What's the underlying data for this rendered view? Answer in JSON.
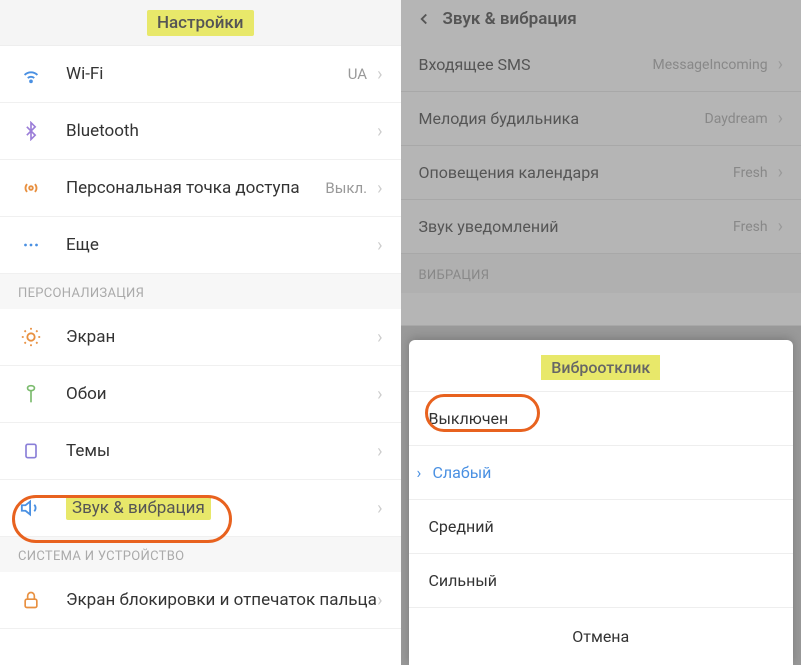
{
  "left": {
    "title": "Настройки",
    "items": [
      {
        "icon": "wifi",
        "color": "#4a90e2",
        "label": "Wi-Fi",
        "value": "UA"
      },
      {
        "icon": "bluetooth",
        "color": "#9b7ed8",
        "label": "Bluetooth",
        "value": ""
      },
      {
        "icon": "hotspot",
        "color": "#e89040",
        "label": "Персональная точка доступа",
        "value": "Выкл."
      },
      {
        "icon": "more",
        "color": "#4a90e2",
        "label": "Еще",
        "value": ""
      }
    ],
    "section1": "ПЕРСОНАЛИЗАЦИЯ",
    "personal": [
      {
        "icon": "display",
        "color": "#e89040",
        "label": "Экран"
      },
      {
        "icon": "wallpaper",
        "color": "#7bbb6d",
        "label": "Обои"
      },
      {
        "icon": "themes",
        "color": "#8a7fd8",
        "label": "Темы"
      },
      {
        "icon": "sound",
        "color": "#4a90e2",
        "label": "Звук & вибрация",
        "highlight": true
      }
    ],
    "section2": "СИСТЕМА И УСТРОЙСТВО",
    "system": [
      {
        "icon": "lock",
        "color": "#e89040",
        "label": "Экран блокировки и отпечаток пальца"
      }
    ]
  },
  "right": {
    "title": "Звук & вибрация",
    "items": [
      {
        "label": "Входящее SMS",
        "value": "MessageIncoming"
      },
      {
        "label": "Мелодия будильника",
        "value": "Daydream"
      },
      {
        "label": "Оповещения календаря",
        "value": "Fresh"
      },
      {
        "label": "Звук уведомлений",
        "value": "Fresh"
      }
    ],
    "section": "ВИБРАЦИЯ"
  },
  "modal": {
    "title": "Виброотклик",
    "options": [
      {
        "label": "Выключен",
        "highlight": true
      },
      {
        "label": "Слабый",
        "selected": true
      },
      {
        "label": "Средний"
      },
      {
        "label": "Сильный"
      }
    ],
    "cancel": "Отмена"
  }
}
